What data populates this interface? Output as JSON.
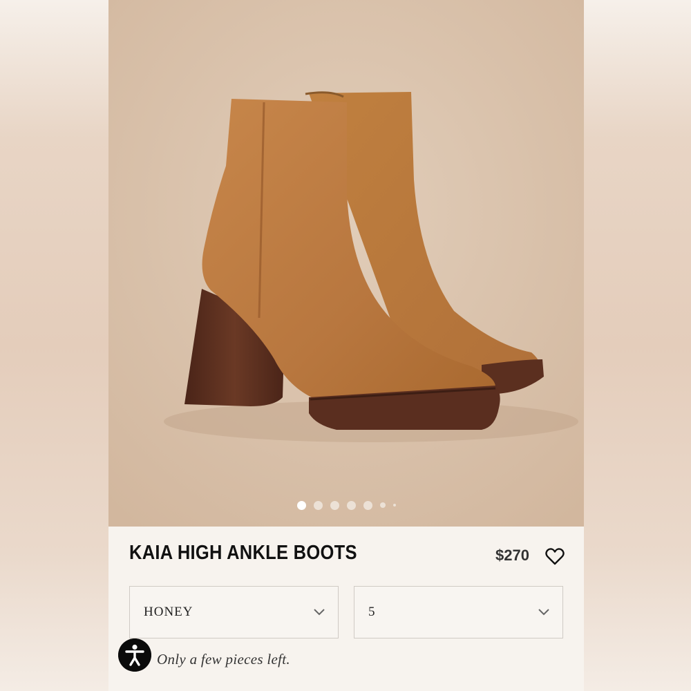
{
  "product": {
    "title": "KAIA HIGH ANKLE BOOTS",
    "price": "$270",
    "stock_note": "Only a few pieces left."
  },
  "options": {
    "color": {
      "selected": "HONEY"
    },
    "size": {
      "selected": "5"
    }
  },
  "gallery": {
    "image_count": 7,
    "active_index": 0
  },
  "icons": {
    "wishlist": "heart-icon",
    "dropdown": "chevron-down-icon",
    "accessibility": "accessibility-icon"
  },
  "colors": {
    "suede": "#b9773e",
    "heel": "#5a2e1f",
    "background": "#d9c1aa",
    "panel": "#f7f3ee"
  }
}
